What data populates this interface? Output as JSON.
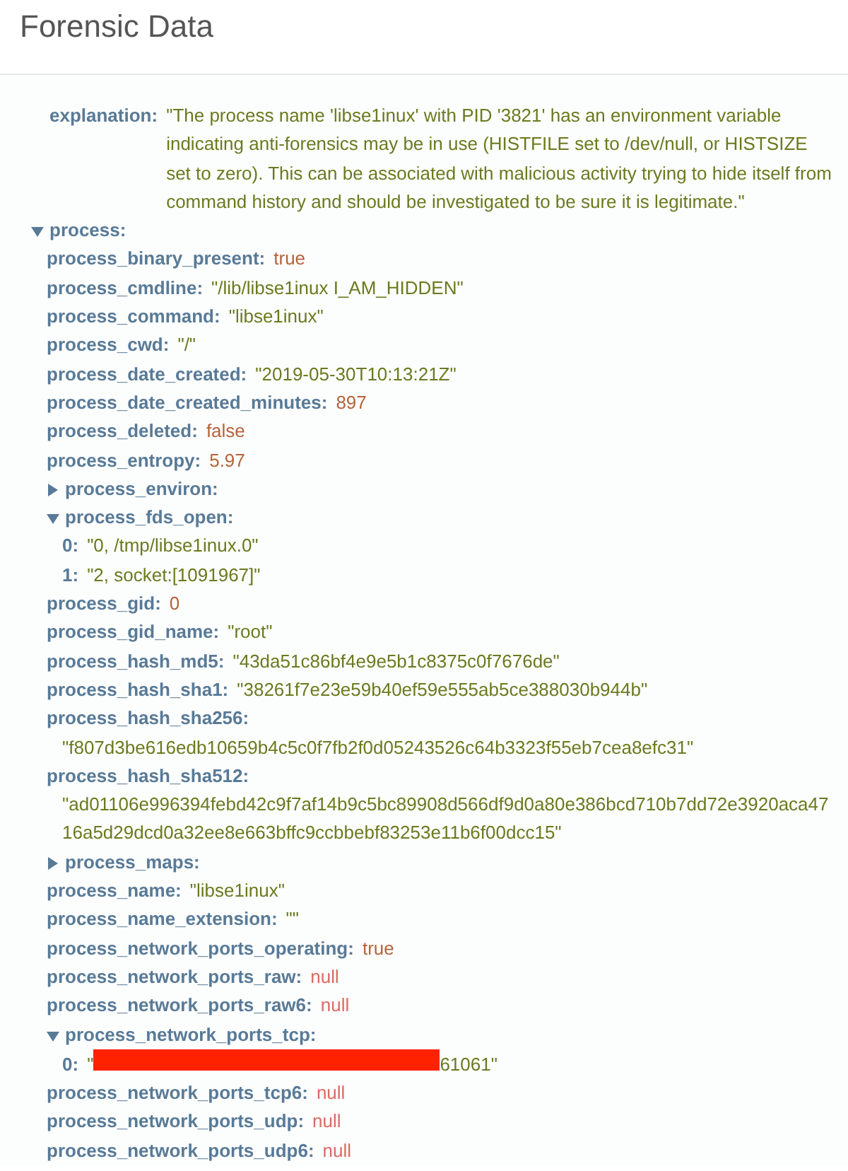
{
  "title": "Forensic Data",
  "tree": [
    {
      "key": "explanation:",
      "kind": "string",
      "value": "\"The process name 'libse1inux' with PID '3821' has an environment variable indicating anti-forensics may be in use (HISTFILE set to /dev/null, or HISTSIZE set to zero). This can be associated with malicious activity trying to hide itself from command history and should be investigated to be sure it is legitimate.\""
    },
    {
      "key": "process:",
      "kind": "object",
      "expanded": true,
      "children": [
        {
          "key": "process_binary_present:",
          "kind": "boolean",
          "value": "true"
        },
        {
          "key": "process_cmdline:",
          "kind": "string",
          "value": "\"/lib/libse1inux I_AM_HIDDEN\""
        },
        {
          "key": "process_command:",
          "kind": "string",
          "value": "\"libse1inux\""
        },
        {
          "key": "process_cwd:",
          "kind": "string",
          "value": "\"/\""
        },
        {
          "key": "process_date_created:",
          "kind": "string",
          "value": "\"2019-05-30T10:13:21Z\""
        },
        {
          "key": "process_date_created_minutes:",
          "kind": "number",
          "value": "897"
        },
        {
          "key": "process_deleted:",
          "kind": "boolean",
          "value": "false"
        },
        {
          "key": "process_entropy:",
          "kind": "number",
          "value": "5.97"
        },
        {
          "key": "process_environ:",
          "kind": "object",
          "expanded": false
        },
        {
          "key": "process_fds_open:",
          "kind": "object",
          "expanded": true,
          "children": [
            {
              "key": "0:",
              "kind": "string",
              "value": "\"0, /tmp/libse1inux.0\""
            },
            {
              "key": "1:",
              "kind": "string",
              "value": "\"2, socket:[1091967]\""
            }
          ]
        },
        {
          "key": "process_gid:",
          "kind": "number",
          "value": "0"
        },
        {
          "key": "process_gid_name:",
          "kind": "string",
          "value": "\"root\""
        },
        {
          "key": "process_hash_md5:",
          "kind": "string",
          "value": "\"43da51c86bf4e9e5b1c8375c0f7676de\""
        },
        {
          "key": "process_hash_sha1:",
          "kind": "string",
          "value": "\"38261f7e23e59b40ef59e555ab5ce388030b944b\""
        },
        {
          "key": "process_hash_sha256:",
          "kind": "string",
          "value": "\"f807d3be616edb10659b4c5c0f7fb2f0d05243526c64b3323f55eb7cea8efc31\""
        },
        {
          "key": "process_hash_sha512:",
          "kind": "string",
          "value": "\"ad01106e996394febd42c9f7af14b9c5bc89908d566df9d0a80e386bcd710b7dd72e3920aca4716a5d29dcd0a32ee8e663bffc9ccbbebf83253e11b6f00dcc15\""
        },
        {
          "key": "process_maps:",
          "kind": "object",
          "expanded": false
        },
        {
          "key": "process_name:",
          "kind": "string",
          "value": "\"libse1inux\""
        },
        {
          "key": "process_name_extension:",
          "kind": "string",
          "value": "\"\""
        },
        {
          "key": "process_network_ports_operating:",
          "kind": "boolean",
          "value": "true"
        },
        {
          "key": "process_network_ports_raw:",
          "kind": "null",
          "value": "null"
        },
        {
          "key": "process_network_ports_raw6:",
          "kind": "null",
          "value": "null"
        },
        {
          "key": "process_network_ports_tcp:",
          "kind": "object",
          "expanded": true,
          "children": [
            {
              "key": "0:",
              "kind": "redacted",
              "value_prefix": "\"",
              "value_suffix": "61061\""
            }
          ]
        },
        {
          "key": "process_network_ports_tcp6:",
          "kind": "null",
          "value": "null"
        },
        {
          "key": "process_network_ports_udp:",
          "kind": "null",
          "value": "null"
        },
        {
          "key": "process_network_ports_udp6:",
          "kind": "null",
          "value": "null"
        }
      ]
    }
  ]
}
